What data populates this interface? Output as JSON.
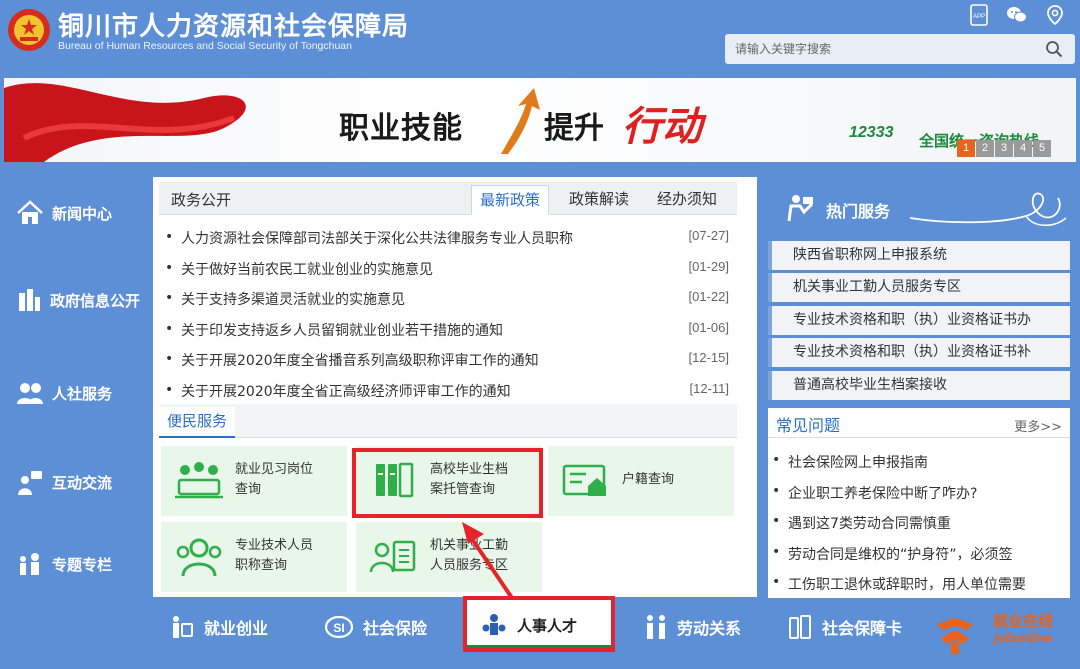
{
  "header": {
    "title": "铜川市人力资源和社会保障局",
    "subtitle": "Bureau of Human Resources and Social Security of Tongchuan",
    "icons": [
      "app-icon",
      "wechat-icon",
      "location-icon"
    ],
    "app_label": "APP",
    "search_placeholder": "请输入关键字搜索"
  },
  "banner": {
    "text1": "职业技能",
    "text2": "提升",
    "text3": "行动",
    "hotline": "12333",
    "right_text": "全国统一咨询热线",
    "pages": [
      "1",
      "2",
      "3",
      "4",
      "5"
    ],
    "active_page": 1
  },
  "left_nav": [
    {
      "label": "新闻中心",
      "icon": "home-icon"
    },
    {
      "label": "政府信息公开",
      "icon": "building-icon"
    },
    {
      "label": "人社服务",
      "icon": "people-icon"
    },
    {
      "label": "互动交流",
      "icon": "chat-person-icon"
    },
    {
      "label": "专题专栏",
      "icon": "family-icon"
    }
  ],
  "center": {
    "section_label": "政务公开",
    "tabs": [
      {
        "label": "最新政策",
        "active": true
      },
      {
        "label": "政策解读",
        "active": false
      },
      {
        "label": "经办须知",
        "active": false
      }
    ],
    "news": [
      {
        "title": "人力资源社会保障部司法部关于深化公共法律服务专业人员职称",
        "date": "[07-27]"
      },
      {
        "title": "关于做好当前农民工就业创业的实施意见",
        "date": "[01-29]"
      },
      {
        "title": "关于支持多渠道灵活就业的实施意见",
        "date": "[01-22]"
      },
      {
        "title": "关于印发支持返乡人员留铜就业创业若干措施的通知",
        "date": "[01-06]"
      },
      {
        "title": "关于开展2020年度全省播音系列高级职称评审工作的通知",
        "date": "[12-15]"
      },
      {
        "title": "关于开展2020年度全省正高级经济师评审工作的通知",
        "date": "[12-11]"
      }
    ],
    "convenience_label": "便民服务",
    "cards": [
      {
        "line1": "就业见习岗位",
        "line2": "查询",
        "icon": "meeting-icon"
      },
      {
        "line1": "高校毕业生档",
        "line2": "案托管查询",
        "icon": "archive-icon",
        "highlighted": true
      },
      {
        "line1": "户籍查询",
        "line2": "",
        "icon": "house-id-icon"
      },
      {
        "line1": "专业技术人员",
        "line2": "职称查询",
        "icon": "group-icon"
      },
      {
        "line1": "机关事业工勤",
        "line2": "人员服务专区",
        "icon": "id-card-icon"
      }
    ]
  },
  "right": {
    "hot_title": "热门服务",
    "hot_items": [
      "陕西省职称网上申报系统",
      "机关事业工勤人员服务专区",
      "专业技术资格和职（执）业资格证书办",
      "专业技术资格和职（执）业资格证书补",
      "普通高校毕业生档案接收"
    ],
    "faq_title": "常见问题",
    "faq_more": "更多>>",
    "faq_items": [
      "社会保险网上申报指南",
      "企业职工养老保险中断了咋办?",
      "遇到这7类劳动合同需慎重",
      "劳动合同是维权的“护身符”，必须签",
      "工伤职工退休或辞职时，用人单位需要"
    ]
  },
  "bottom_nav": [
    {
      "label": "就业创业",
      "icon": "job-icon"
    },
    {
      "label": "社会保险",
      "icon": "si-icon"
    },
    {
      "label": "人事人才",
      "icon": "talent-icon",
      "highlighted": true
    },
    {
      "label": "劳动关系",
      "icon": "labor-icon"
    },
    {
      "label": "社会保障卡",
      "icon": "card-icon"
    }
  ],
  "job_online": {
    "line1": "就业在线",
    "line2": "jobonline"
  },
  "colors": {
    "primary": "#5d8fd6",
    "highlight": "#e5232b",
    "card_green": "#e9f7ea",
    "icon_green": "#2fae4a",
    "link_blue": "#2b6fc4"
  }
}
